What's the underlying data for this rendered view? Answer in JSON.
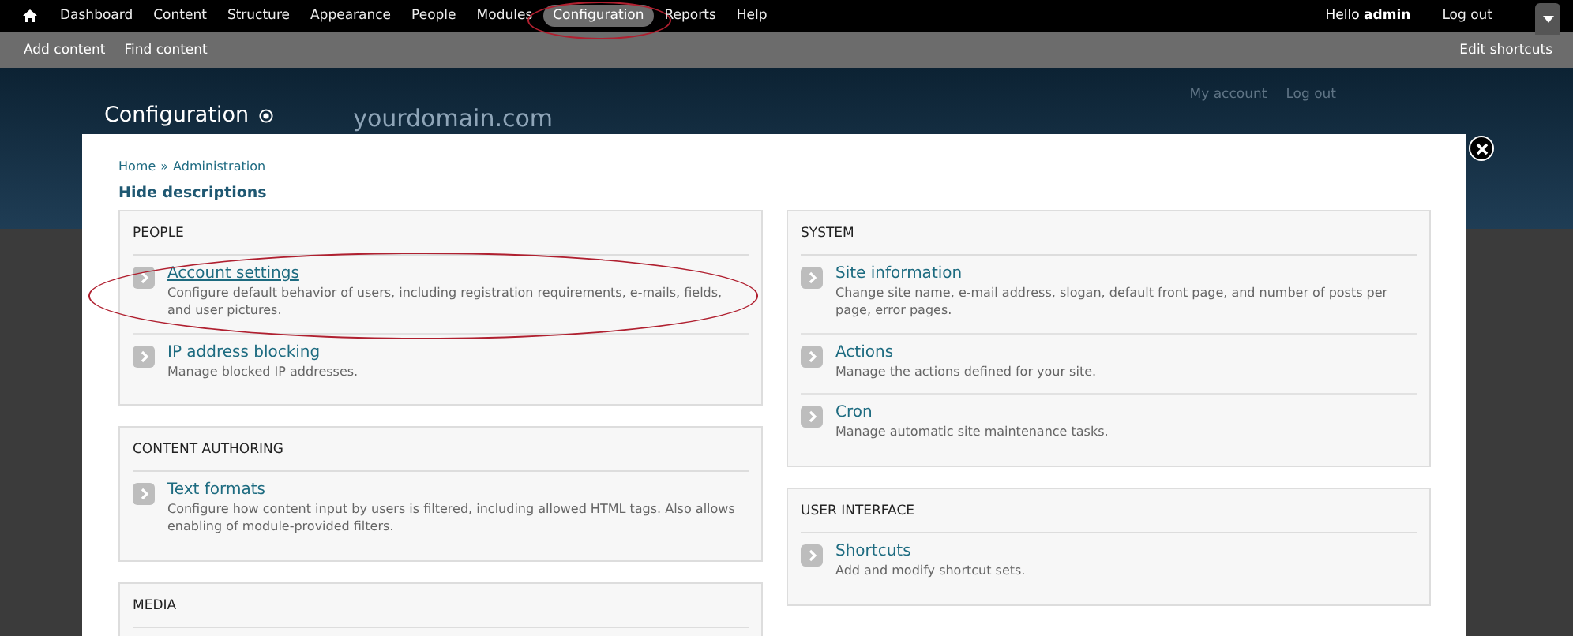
{
  "toolbar": {
    "items": [
      {
        "label": "Dashboard",
        "selected": false,
        "circled": false
      },
      {
        "label": "Content",
        "selected": false,
        "circled": false
      },
      {
        "label": "Structure",
        "selected": false,
        "circled": false
      },
      {
        "label": "Appearance",
        "selected": false,
        "circled": false
      },
      {
        "label": "People",
        "selected": false,
        "circled": false
      },
      {
        "label": "Modules",
        "selected": false,
        "circled": false
      },
      {
        "label": "Configuration",
        "selected": true,
        "circled": true
      },
      {
        "label": "Reports",
        "selected": false,
        "circled": false
      },
      {
        "label": "Help",
        "selected": false,
        "circled": false
      }
    ],
    "greeting": "Hello",
    "user": "admin",
    "logout": "Log out"
  },
  "shortcuts": {
    "items": [
      "Add content",
      "Find content"
    ],
    "edit": "Edit shortcuts"
  },
  "header": {
    "title": "Configuration",
    "site_name": "yourdomain.com",
    "links": [
      "My account",
      "Log out"
    ]
  },
  "overlay": {
    "breadcrumb": [
      "Home",
      "Administration"
    ],
    "separator": "»",
    "toggle": "Hide descriptions",
    "columns": [
      [
        {
          "title": "PEOPLE",
          "items": [
            {
              "title": "Account settings",
              "description": "Configure default behavior of users, including registration requirements, e-mails, fields, and user pictures.",
              "hovered": true,
              "circled": true
            },
            {
              "title": "IP address blocking",
              "description": "Manage blocked IP addresses.",
              "hovered": false,
              "circled": false
            }
          ]
        },
        {
          "title": "CONTENT AUTHORING",
          "items": [
            {
              "title": "Text formats",
              "description": "Configure how content input by users is filtered, including allowed HTML tags. Also allows enabling of module-provided filters.",
              "hovered": false,
              "circled": false
            }
          ]
        },
        {
          "title": "MEDIA"
        }
      ],
      [
        {
          "title": "SYSTEM",
          "items": [
            {
              "title": "Site information",
              "description": "Change site name, e-mail address, slogan, default front page, and number of posts per page, error pages.",
              "hovered": false,
              "circled": false
            },
            {
              "title": "Actions",
              "description": "Manage the actions defined for your site.",
              "hovered": false,
              "circled": false
            },
            {
              "title": "Cron",
              "description": "Manage automatic site maintenance tasks.",
              "hovered": false,
              "circled": false
            }
          ]
        },
        {
          "title": "USER INTERFACE",
          "items": [
            {
              "title": "Shortcuts",
              "description": "Add and modify shortcut sets.",
              "hovered": false,
              "circled": false
            }
          ]
        }
      ]
    ]
  }
}
